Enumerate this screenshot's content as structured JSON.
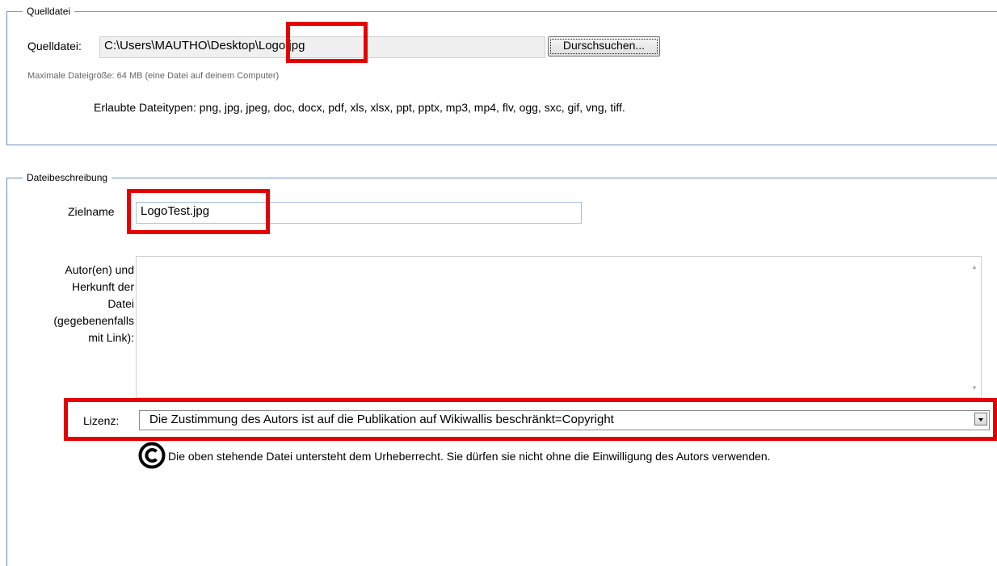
{
  "source_section": {
    "legend": "Quelldatei",
    "label": "Quelldatei:",
    "file_path": "C:\\Users\\MAUTHO\\Desktop\\Logo.jpg",
    "browse_button": "Durschsuchen...",
    "max_size_hint": "Maximale Dateigröße: 64 MB (eine Datei auf deinem Computer)",
    "allowed_types": "Erlaubte Dateitypen: png, jpg, jpeg, doc, docx, pdf, xls, xlsx, ppt, pptx, mp3, mp4, flv, ogg, sxc, gif, vng, tiff."
  },
  "description_section": {
    "legend": "Dateibeschreibung",
    "target_name_label": "Zielname",
    "target_name_value": "LogoTest.jpg",
    "author_label_lines": [
      "Autor(en) und",
      "Herkunft der",
      "Datei",
      "(gegebenenfalls",
      "mit Link):"
    ],
    "author_value": "",
    "license_label": "Lizenz:",
    "license_selected": "Die Zustimmung des Autors ist auf die Publikation auf Wikiwallis beschränkt=Copyright",
    "copyright_notice": "Die oben stehende Datei untersteht dem Urheberrecht. Sie dürfen sie nicht ohne die Einwilligung des Autors verwenden."
  },
  "icons": {
    "copyright": "copyright-icon",
    "dropdown": "chevron-down-icon"
  },
  "colors": {
    "highlight": "#e50000",
    "fieldset_border": "#6d8fbf"
  }
}
